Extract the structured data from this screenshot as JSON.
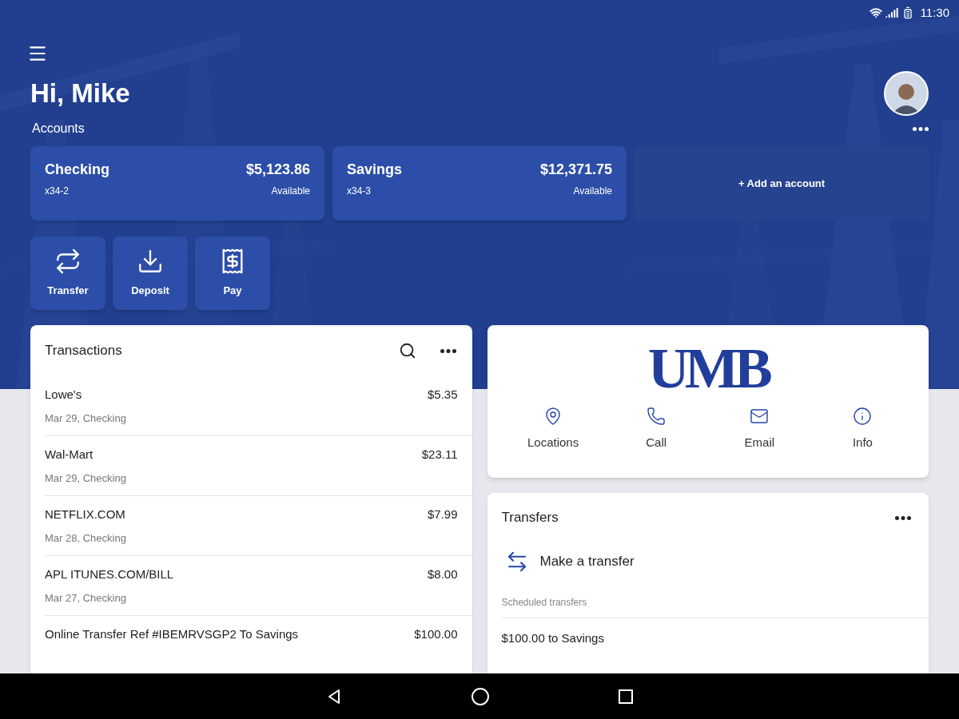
{
  "status_bar": {
    "time": "11:30"
  },
  "greeting": "Hi, Mike",
  "accounts": {
    "label": "Accounts",
    "items": [
      {
        "kind": "account",
        "name": "Checking",
        "number": "x34-2",
        "balance": "$5,123.86",
        "balance_label": "Available"
      },
      {
        "kind": "account",
        "name": "Savings",
        "number": "x34-3",
        "balance": "$12,371.75",
        "balance_label": "Available"
      },
      {
        "kind": "add",
        "label": "+ Add an account"
      }
    ]
  },
  "actions": [
    {
      "kind": "transfer",
      "label": "Transfer"
    },
    {
      "kind": "deposit",
      "label": "Deposit"
    },
    {
      "kind": "pay",
      "label": "Pay"
    }
  ],
  "transactions": {
    "title": "Transactions",
    "rows": [
      {
        "name": "Lowe's",
        "amount": "$5.35",
        "detail": "Mar 29, Checking"
      },
      {
        "name": "Wal-Mart",
        "amount": "$23.11",
        "detail": "Mar 29, Checking"
      },
      {
        "name": "NETFLIX.COM",
        "amount": "$7.99",
        "detail": "Mar 28, Checking"
      },
      {
        "name": "APL ITUNES.COM/BILL",
        "amount": "$8.00",
        "detail": "Mar 27, Checking"
      },
      {
        "name": "Online Transfer Ref #IBEMRVSGP2 To Savings",
        "amount": "$100.00"
      }
    ]
  },
  "bank": {
    "logo": "UMB",
    "links": [
      {
        "kind": "location",
        "label": "Locations"
      },
      {
        "kind": "call",
        "label": "Call"
      },
      {
        "kind": "email",
        "label": "Email"
      },
      {
        "kind": "info",
        "label": "Info"
      }
    ]
  },
  "transfers": {
    "title": "Transfers",
    "action": "Make a transfer",
    "scheduled_label": "Scheduled transfers",
    "scheduled": [
      "$100.00 to Savings"
    ]
  }
}
